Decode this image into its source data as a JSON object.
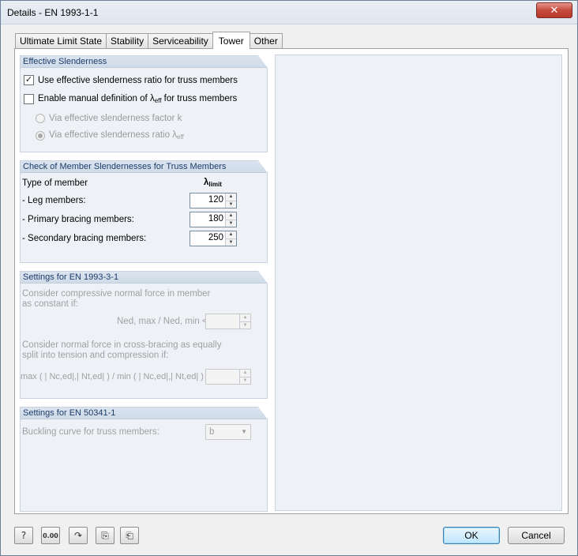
{
  "window": {
    "title": "Details - EN 1993-1-1",
    "close_glyph": "✕"
  },
  "tabs": [
    {
      "label": "Ultimate Limit State",
      "active": false
    },
    {
      "label": "Stability",
      "active": false
    },
    {
      "label": "Serviceability",
      "active": false
    },
    {
      "label": "Tower",
      "active": true
    },
    {
      "label": "Other",
      "active": false
    }
  ],
  "effective_slenderness": {
    "header": "Effective Slenderness",
    "use_effective_checkbox": {
      "label": "Use effective slenderness ratio for truss members",
      "checked": true
    },
    "manual_definition_checkbox": {
      "label_prefix": "Enable manual definition of ",
      "lambda": "λ",
      "sub": "eff",
      "label_suffix": " for truss members",
      "checked": false
    },
    "radio_factor_k": {
      "label": "Via effective slenderness factor k",
      "selected": false
    },
    "radio_ratio": {
      "label_prefix": "Via effective slenderness ratio ",
      "lambda": "λ",
      "sub": "eff",
      "selected": true
    }
  },
  "check_member_slenderness": {
    "header": "Check of Member Slendernesses for Truss Members",
    "col_type": "Type of member",
    "col_lambda": "λ",
    "col_lambda_sub": "limit",
    "rows": [
      {
        "label": "- Leg members:",
        "value": "120"
      },
      {
        "label": "- Primary bracing members:",
        "value": "180"
      },
      {
        "label": "- Secondary bracing members:",
        "value": "250"
      }
    ]
  },
  "settings_1993_3_1": {
    "header": "Settings for EN 1993-3-1",
    "text1": "Consider compressive normal force in member as constant if:",
    "ratio1": "Ned, max / Ned, min <",
    "ratio1_value": "",
    "text2": "Consider normal force in cross-bracing as equally split into tension and compression if:",
    "ratio2": "max ( | Nc,ed|,| Nt,ed| ) / min ( | Nc,ed|,| Nt,ed| ) <",
    "ratio2_value": ""
  },
  "settings_50341_1": {
    "header": "Settings for EN 50341-1",
    "buckling_label": "Buckling curve for truss members:",
    "buckling_value": "b"
  },
  "bottom": {
    "icon_buttons": [
      "help-icon",
      "decimal-places-icon",
      "reset-icon",
      "export-icon",
      "import-icon"
    ],
    "decimal_glyph": "0.00",
    "ok_label": "OK",
    "cancel_label": "Cancel"
  },
  "colors": {
    "group_header_text": "#1c3c6a",
    "close_button": "#c64a3e",
    "ok_border": "#3c7fb1"
  }
}
